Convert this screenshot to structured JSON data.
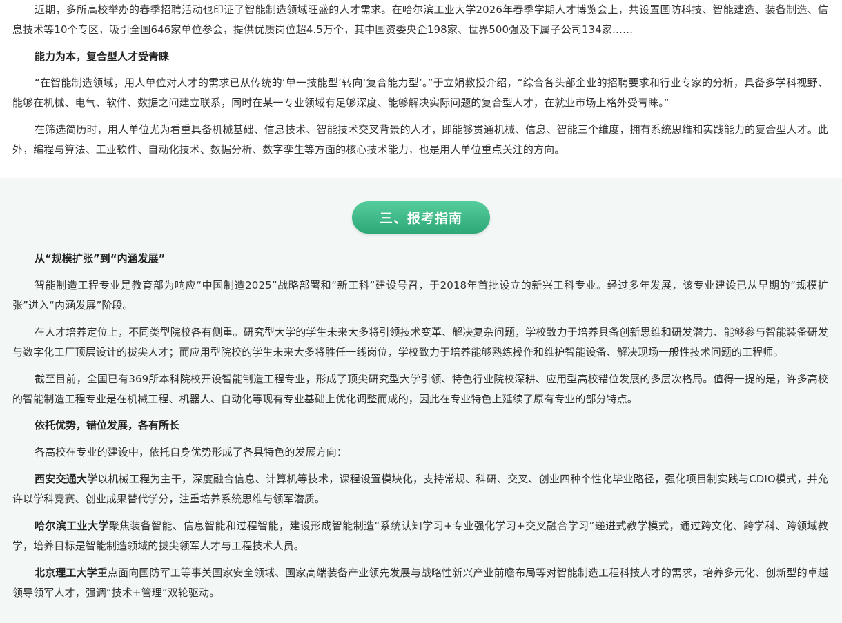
{
  "top": {
    "p1": "近期，多所高校举办的春季招聘活动也印证了智能制造领域旺盛的人才需求。在哈尔滨工业大学2026年春季学期人才博览会上，共设置国防科技、智能建造、装备制造、信息技术等10个专区，吸引全国646家单位参会，提供优质岗位超4.5万个，其中国资委央企198家、世界500强及下属子公司134家……",
    "heading": "能力为本，复合型人才受青睐",
    "p2": "“在智能制造领域，用人单位对人才的需求已从传统的‘单一技能型’转向‘复合能力型’。”于立娟教授介绍，“综合各头部企业的招聘要求和行业专家的分析，具备多学科视野、能够在机械、电气、软件、数据之间建立联系，同时在某一专业领域有足够深度、能够解决实际问题的复合型人才，在就业市场上格外受青睐。”",
    "p3": "在筛选简历时，用人单位尤为看重具备机械基础、信息技术、智能技术交叉背景的人才，即能够贯通机械、信息、智能三个维度，拥有系统思维和实践能力的复合型人才。此外，编程与算法、工业软件、自动化技术、数据分析、数字孪生等方面的核心技术能力，也是用人单位重点关注的方向。"
  },
  "section3": {
    "title": "三、报考指南",
    "heading1": "从“规模扩张”到“内涵发展”",
    "p1": "智能制造工程专业是教育部为响应“中国制造2025”战略部署和“新工科”建设号召，于2018年首批设立的新兴工科专业。经过多年发展，该专业建设已从早期的“规模扩张”进入“内涵发展”阶段。",
    "p2": "在人才培养定位上，不同类型院校各有侧重。研究型大学的学生未来大多将引领技术变革、解决复杂问题，学校致力于培养具备创新思维和研发潜力、能够参与智能装备研发与数字化工厂顶层设计的拔尖人才；而应用型院校的学生未来大多将胜任一线岗位，学校致力于培养能够熟练操作和维护智能设备、解决现场一般性技术问题的工程师。",
    "p3": "截至目前，全国已有369所本科院校开设智能制造工程专业，形成了顶尖研究型大学引领、特色行业院校深耕、应用型高校错位发展的多层次格局。值得一提的是，许多高校的智能制造工程专业是在机械工程、机器人、自动化等现有专业基础上优化调整而成的，因此在专业特色上延续了原有专业的部分特点。",
    "heading2": "依托优势，错位发展，各有所长",
    "p4": "各高校在专业的建设中，依托自身优势形成了各具特色的发展方向：",
    "u1_name": "西安交通大学",
    "u1_text": "以机械工程为主干，深度融合信息、计算机等技术，课程设置模块化，支持常规、科研、交叉、创业四种个性化毕业路径，强化项目制实践与CDIO模式，并允许以学科竞赛、创业成果替代学分，注重培养系统思维与领军潜质。",
    "u2_name": "哈尔滨工业大学",
    "u2_text": "聚焦装备智能、信息智能和过程智能，建设形成智能制造“系统认知学习+专业强化学习+交叉融合学习”递进式教学模式，通过跨文化、跨学科、跨领域教学，培养目标是智能制造领域的拔尖领军人才与工程技术人员。",
    "u3_name": "北京理工大学",
    "u3_text": "重点面向国防军工等事关国家安全领域、国家高端装备产业领先发展与战略性新兴产业前瞻布局等对智能制造工程科技人才的需求，培养多元化、创新型的卓越领导领军人才，强调“技术+管理”双轮驱动。"
  },
  "colors": {
    "accent_green": "#2ea877",
    "section_bg": "#f3f8f6"
  }
}
